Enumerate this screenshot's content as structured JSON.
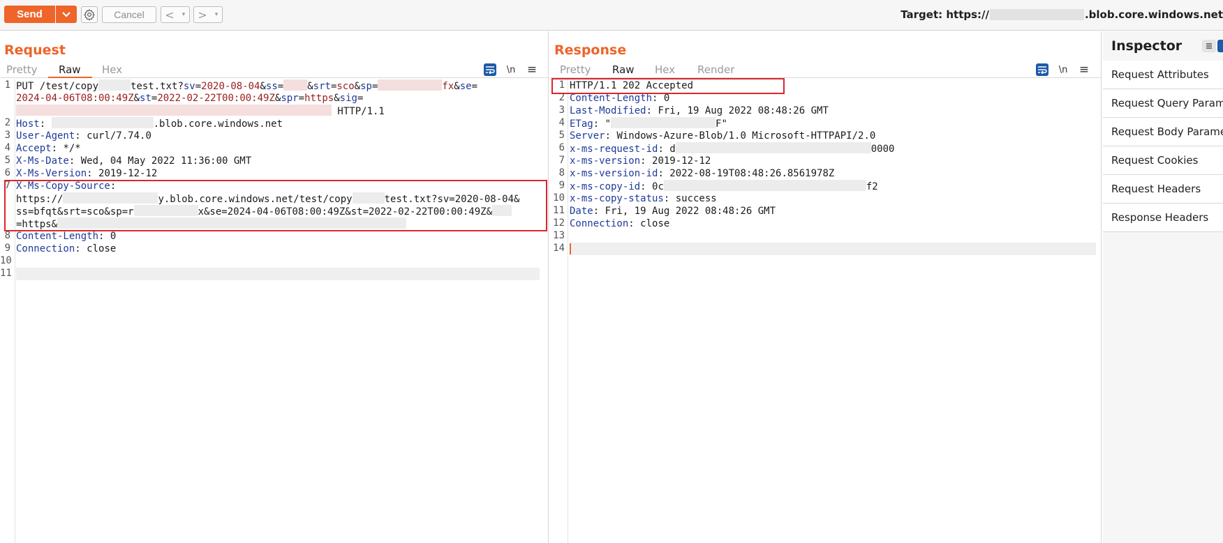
{
  "toolbar": {
    "send_label": "Send",
    "cancel_label": "Cancel",
    "back_glyph": "<",
    "forward_glyph": ">",
    "dropdown_glyph": "▾",
    "target_prefix": "Target: https://",
    "target_suffix": ".blob.core.windows.net"
  },
  "request": {
    "title": "Request",
    "tabs": [
      "Pretty",
      "Raw",
      "Hex"
    ],
    "active_tab": "Raw",
    "lines": {
      "l1a_pre": "PUT /test/copy",
      "l1a_mid": "test.txt?",
      "l1a_sv_k": "sv",
      "l1a_sv_v": "2020-08-04",
      "l1a_ss_k": "ss",
      "l1a_srt_k": "srt",
      "l1a_srt_v": "sco",
      "l1a_sp_k": "sp",
      "l1a_sp_tail": "fx",
      "l1a_se_k": "se",
      "l1b_se_v": "2024-04-06T08:00:49Z",
      "l1b_st_k": "st",
      "l1b_st_v": "2022-02-22T00:00:49Z",
      "l1b_spr_k": "spr",
      "l1b_spr_v": "https",
      "l1b_sig_k": "sig",
      "l1c_tail": " HTTP/1.1",
      "host_k": "Host",
      "host_v_suffix": ".blob.core.windows.net",
      "ua_k": "User-Agent",
      "ua_v": "curl/7.74.0",
      "accept_k": "Accept",
      "accept_v": "*/*",
      "date_k": "X-Ms-Date",
      "date_v": "Wed, 04 May 2022 11:36:00 GMT",
      "ver_k": "X-Ms-Version",
      "ver_v": "2019-12-12",
      "copy_k": "X-Ms-Copy-Source",
      "copy_l2_pre": "https://",
      "copy_l2_mid": "y.blob.core.windows.net/test/copy",
      "copy_l2_tail": "test.txt?sv=2020-08-04&",
      "copy_l3_pre": "ss=bfqt&srt=sco&sp=r",
      "copy_l3_mid": "x&se=2024-04-06T08:00:49Z&st=2022-02-22T00:00:49Z&",
      "copy_l4_pre": "=https&",
      "cl_k": "Content-Length",
      "cl_v": "0",
      "conn_k": "Connection",
      "conn_v": "close"
    },
    "line_numbers": [
      "1",
      "2",
      "3",
      "4",
      "5",
      "6",
      "7",
      "8",
      "9",
      "10",
      "11"
    ]
  },
  "response": {
    "title": "Response",
    "tabs": [
      "Pretty",
      "Raw",
      "Hex",
      "Render"
    ],
    "active_tab": "Raw",
    "status": "HTTP/1.1 202 Accepted",
    "lines": {
      "cl_k": "Content-Length",
      "cl_v": "0",
      "lm_k": "Last-Modified",
      "lm_v": "Fri, 19 Aug 2022 08:48:26 GMT",
      "etag_k": "ETag",
      "etag_pre": "\"",
      "etag_tail": "F\"",
      "server_k": "Server",
      "server_v": "Windows-Azure-Blob/1.0 Microsoft-HTTPAPI/2.0",
      "rid_k": "x-ms-request-id",
      "rid_pre": "d",
      "rid_tail": "0000",
      "ver_k": "x-ms-version",
      "ver_v": "2019-12-12",
      "vid_k": "x-ms-version-id",
      "vid_v": "2022-08-19T08:48:26.8561978Z",
      "cid_k": "x-ms-copy-id",
      "cid_pre": "0c",
      "cid_tail": "f2",
      "cst_k": "x-ms-copy-status",
      "cst_v": "success",
      "date_k": "Date",
      "date_v": "Fri, 19 Aug 2022 08:48:26 GMT",
      "conn_k": "Connection",
      "conn_v": "close"
    },
    "line_numbers": [
      "1",
      "2",
      "3",
      "4",
      "5",
      "6",
      "7",
      "8",
      "9",
      "10",
      "11",
      "12",
      "13",
      "14"
    ]
  },
  "inspector": {
    "title": "Inspector",
    "items": [
      "Request Attributes",
      "Request Query Parameters",
      "Request Body Parameters",
      "Request Cookies",
      "Request Headers",
      "Response Headers"
    ]
  },
  "icons": {
    "wrap": "wrap-lines-icon",
    "newline": "\\n",
    "menu": "≡"
  },
  "colors": {
    "accent": "#ee6429",
    "highlight_box": "#d9262c",
    "header_key": "#1f3a99",
    "param_value": "#9a1c1c",
    "active_toggle": "#1d5aa8"
  }
}
